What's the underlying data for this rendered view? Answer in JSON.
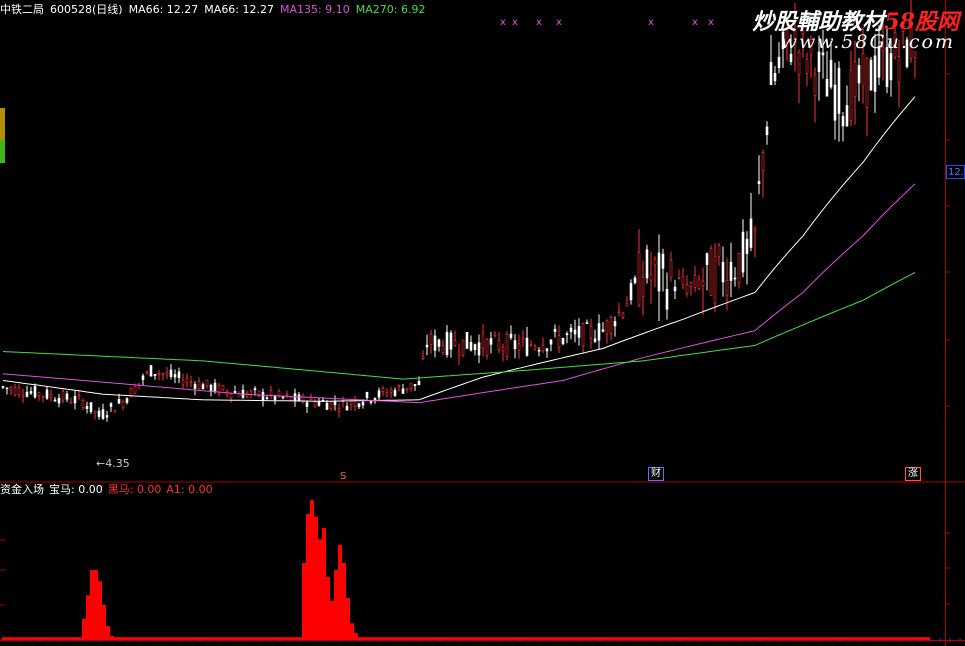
{
  "header": {
    "stock_name": "中铁二局",
    "stock_code": "600528(日线)",
    "ma_items": [
      {
        "label": "MA66: 12.27",
        "color": "#ffffff"
      },
      {
        "label": "MA66: 12.27",
        "color": "#ffffff"
      },
      {
        "label": "MA135: 9.10",
        "color": "#e050e0"
      },
      {
        "label": "MA270: 6.92",
        "color": "#40e040"
      }
    ]
  },
  "watermark": {
    "title_white": "炒股輔助教材",
    "title_red": "58股网",
    "url": "www.58Gu.com"
  },
  "price_tag": "12.",
  "low_label": "←4.35",
  "markers": {
    "s": "S",
    "cai": "财",
    "zhang": "涨"
  },
  "subchart": {
    "items": [
      {
        "label": "资金入场",
        "color": "#ffffff"
      },
      {
        "label": "宝马: 0.00",
        "color": "#ffffff"
      },
      {
        "label": "黑马: 0.00",
        "color": "#ff3030"
      },
      {
        "label": "A1: 0.00",
        "color": "#ff3030"
      }
    ]
  },
  "chart_data": [
    {
      "type": "candlestick",
      "title": "中铁二局 600528(日线)",
      "y_scale": "log",
      "ylim": [
        3.6,
        15.0
      ],
      "low_marker": 4.35,
      "last_price": 12.27,
      "x_markers": [
        {
          "label": "S",
          "index": 85
        },
        {
          "label": "财",
          "index": 160
        },
        {
          "label": "涨",
          "index": 226
        }
      ],
      "top_markers": "x",
      "top_marker_indices": [
        125,
        128,
        134,
        139,
        162,
        173,
        177
      ],
      "segments": [
        {
          "to": 0,
          "price": 4.8
        },
        {
          "to": 20,
          "price": 4.6
        },
        {
          "to": 24,
          "price": 4.4
        },
        {
          "to": 30,
          "price": 4.6
        },
        {
          "to": 37,
          "price": 5.05
        },
        {
          "to": 55,
          "price": 4.75
        },
        {
          "to": 85,
          "price": 4.55
        },
        {
          "to": 104,
          "price": 4.85
        },
        {
          "to": 106,
          "price": 5.5
        },
        {
          "to": 130,
          "price": 5.45
        },
        {
          "to": 150,
          "price": 5.7
        },
        {
          "to": 155,
          "price": 6.1
        },
        {
          "to": 160,
          "price": 6.8
        },
        {
          "to": 172,
          "price": 6.5
        },
        {
          "to": 185,
          "price": 7.1
        },
        {
          "to": 188,
          "price": 7.5
        },
        {
          "to": 192,
          "price": 12.0
        },
        {
          "to": 197,
          "price": 13.8
        },
        {
          "to": 210,
          "price": 11.5
        },
        {
          "to": 228,
          "price": 13.8
        }
      ],
      "moving_averages": [
        {
          "name": "MA66",
          "value": 12.27,
          "color": "#ffffff",
          "path": [
            [
              0,
              4.9
            ],
            [
              25,
              4.7
            ],
            [
              50,
              4.62
            ],
            [
              80,
              4.6
            ],
            [
              104,
              4.62
            ],
            [
              120,
              4.95
            ],
            [
              150,
              5.4
            ],
            [
              170,
              5.9
            ],
            [
              188,
              6.4
            ],
            [
              200,
              7.6
            ],
            [
              215,
              9.5
            ],
            [
              228,
              11.6
            ]
          ]
        },
        {
          "name": "MA135",
          "value": 9.1,
          "color": "#e050e0",
          "path": [
            [
              0,
              5.0
            ],
            [
              30,
              4.85
            ],
            [
              60,
              4.7
            ],
            [
              104,
              4.58
            ],
            [
              140,
              4.9
            ],
            [
              160,
              5.25
            ],
            [
              188,
              5.7
            ],
            [
              200,
              6.4
            ],
            [
              215,
              7.6
            ],
            [
              228,
              8.9
            ]
          ]
        },
        {
          "name": "MA270",
          "value": 6.92,
          "color": "#40e040",
          "path": [
            [
              0,
              5.35
            ],
            [
              50,
              5.2
            ],
            [
              100,
              4.92
            ],
            [
              130,
              5.05
            ],
            [
              160,
              5.2
            ],
            [
              188,
              5.45
            ],
            [
              200,
              5.8
            ],
            [
              215,
              6.25
            ],
            [
              228,
              6.8
            ]
          ]
        }
      ]
    },
    {
      "type": "bar",
      "title": "资金入场",
      "series": [
        {
          "name": "黑马",
          "color": "#ff0000",
          "values": [
            0.02,
            0.02,
            0.02,
            0.02,
            0.02,
            0.02,
            0.02,
            0.02,
            0.02,
            0.02,
            0.02,
            0.02,
            0.02,
            0.02,
            0.02,
            0.02,
            0.02,
            0.02,
            0.02,
            0.02,
            0.15,
            0.32,
            0.5,
            0.5,
            0.42,
            0.25,
            0.1,
            0.03,
            0.02,
            0.02,
            0.02,
            0.02,
            0.02,
            0.02,
            0.02,
            0.02,
            0.02,
            0.02,
            0.02,
            0.02,
            0.02,
            0.02,
            0.02,
            0.02,
            0.02,
            0.02,
            0.02,
            0.02,
            0.02,
            0.02,
            0.02,
            0.02,
            0.02,
            0.02,
            0.02,
            0.02,
            0.02,
            0.02,
            0.02,
            0.02,
            0.02,
            0.02,
            0.02,
            0.02,
            0.02,
            0.02,
            0.02,
            0.02,
            0.02,
            0.02,
            0.02,
            0.02,
            0.02,
            0.02,
            0.02,
            0.55,
            0.9,
            1.0,
            0.88,
            0.72,
            0.8,
            0.45,
            0.28,
            0.5,
            0.68,
            0.55,
            0.3,
            0.12,
            0.05,
            0.02,
            0.02,
            0.02,
            0.02,
            0.02,
            0.02,
            0.02,
            0.02,
            0.02,
            0.02,
            0.02,
            0.02,
            0.02,
            0.02,
            0.02,
            0.02,
            0.02,
            0.02,
            0.02,
            0.02,
            0.02,
            0.02,
            0.02,
            0.02,
            0.02,
            0.02,
            0.02,
            0.02,
            0.02,
            0.02,
            0.02,
            0.02,
            0.02,
            0.02,
            0.02,
            0.02,
            0.02,
            0.02,
            0.02,
            0.02,
            0.02,
            0.02,
            0.02,
            0.02,
            0.02,
            0.02,
            0.02,
            0.02,
            0.02,
            0.02,
            0.02,
            0.02,
            0.02,
            0.02,
            0.02,
            0.02,
            0.02,
            0.02,
            0.02,
            0.02,
            0.02,
            0.02,
            0.02,
            0.02,
            0.02,
            0.02,
            0.02,
            0.02,
            0.02,
            0.02,
            0.02,
            0.02,
            0.02,
            0.02,
            0.02,
            0.02,
            0.02,
            0.02,
            0.02,
            0.02,
            0.02,
            0.02,
            0.02,
            0.02,
            0.02,
            0.02,
            0.02,
            0.02,
            0.02,
            0.02,
            0.02,
            0.02,
            0.02,
            0.02,
            0.02,
            0.02,
            0.02,
            0.02,
            0.02,
            0.02,
            0.02,
            0.02,
            0.02,
            0.02,
            0.02,
            0.02,
            0.02,
            0.02,
            0.02,
            0.02,
            0.02,
            0.02,
            0.02,
            0.02,
            0.02,
            0.02,
            0.02,
            0.02,
            0.02,
            0.02,
            0.02,
            0.02,
            0.02,
            0.02,
            0.02,
            0.02,
            0.02,
            0.02,
            0.02,
            0.02,
            0.02,
            0.02,
            0.02,
            0.02,
            0.02,
            0.02,
            0.02,
            0.02,
            0.02,
            0.02,
            0.02,
            0.02,
            0.02
          ]
        }
      ]
    }
  ],
  "colors": {
    "background": "#000000",
    "frame": "#b00000",
    "candle_up": "#ff3030",
    "candle_down": "#ffffff",
    "bar": "#ff0000"
  }
}
